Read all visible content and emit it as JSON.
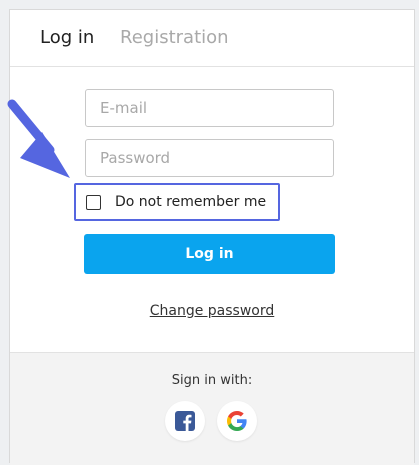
{
  "tabs": [
    {
      "label": "Log in",
      "active": true
    },
    {
      "label": "Registration",
      "active": false
    }
  ],
  "form": {
    "email_placeholder": "E-mail",
    "password_placeholder": "Password",
    "remember_label": "Do not remember me",
    "remember_checked": false,
    "login_button": "Log in",
    "change_password_link": "Change password"
  },
  "social": {
    "label": "Sign in with:",
    "providers": [
      {
        "name": "facebook",
        "icon": "facebook-icon",
        "color": "#3b5998"
      },
      {
        "name": "google",
        "icon": "google-icon"
      }
    ]
  },
  "annotation": {
    "arrow_icon": "arrow-pointer-icon",
    "highlight_color": "#5566e0"
  },
  "colors": {
    "accent": "#0aa4ee"
  }
}
